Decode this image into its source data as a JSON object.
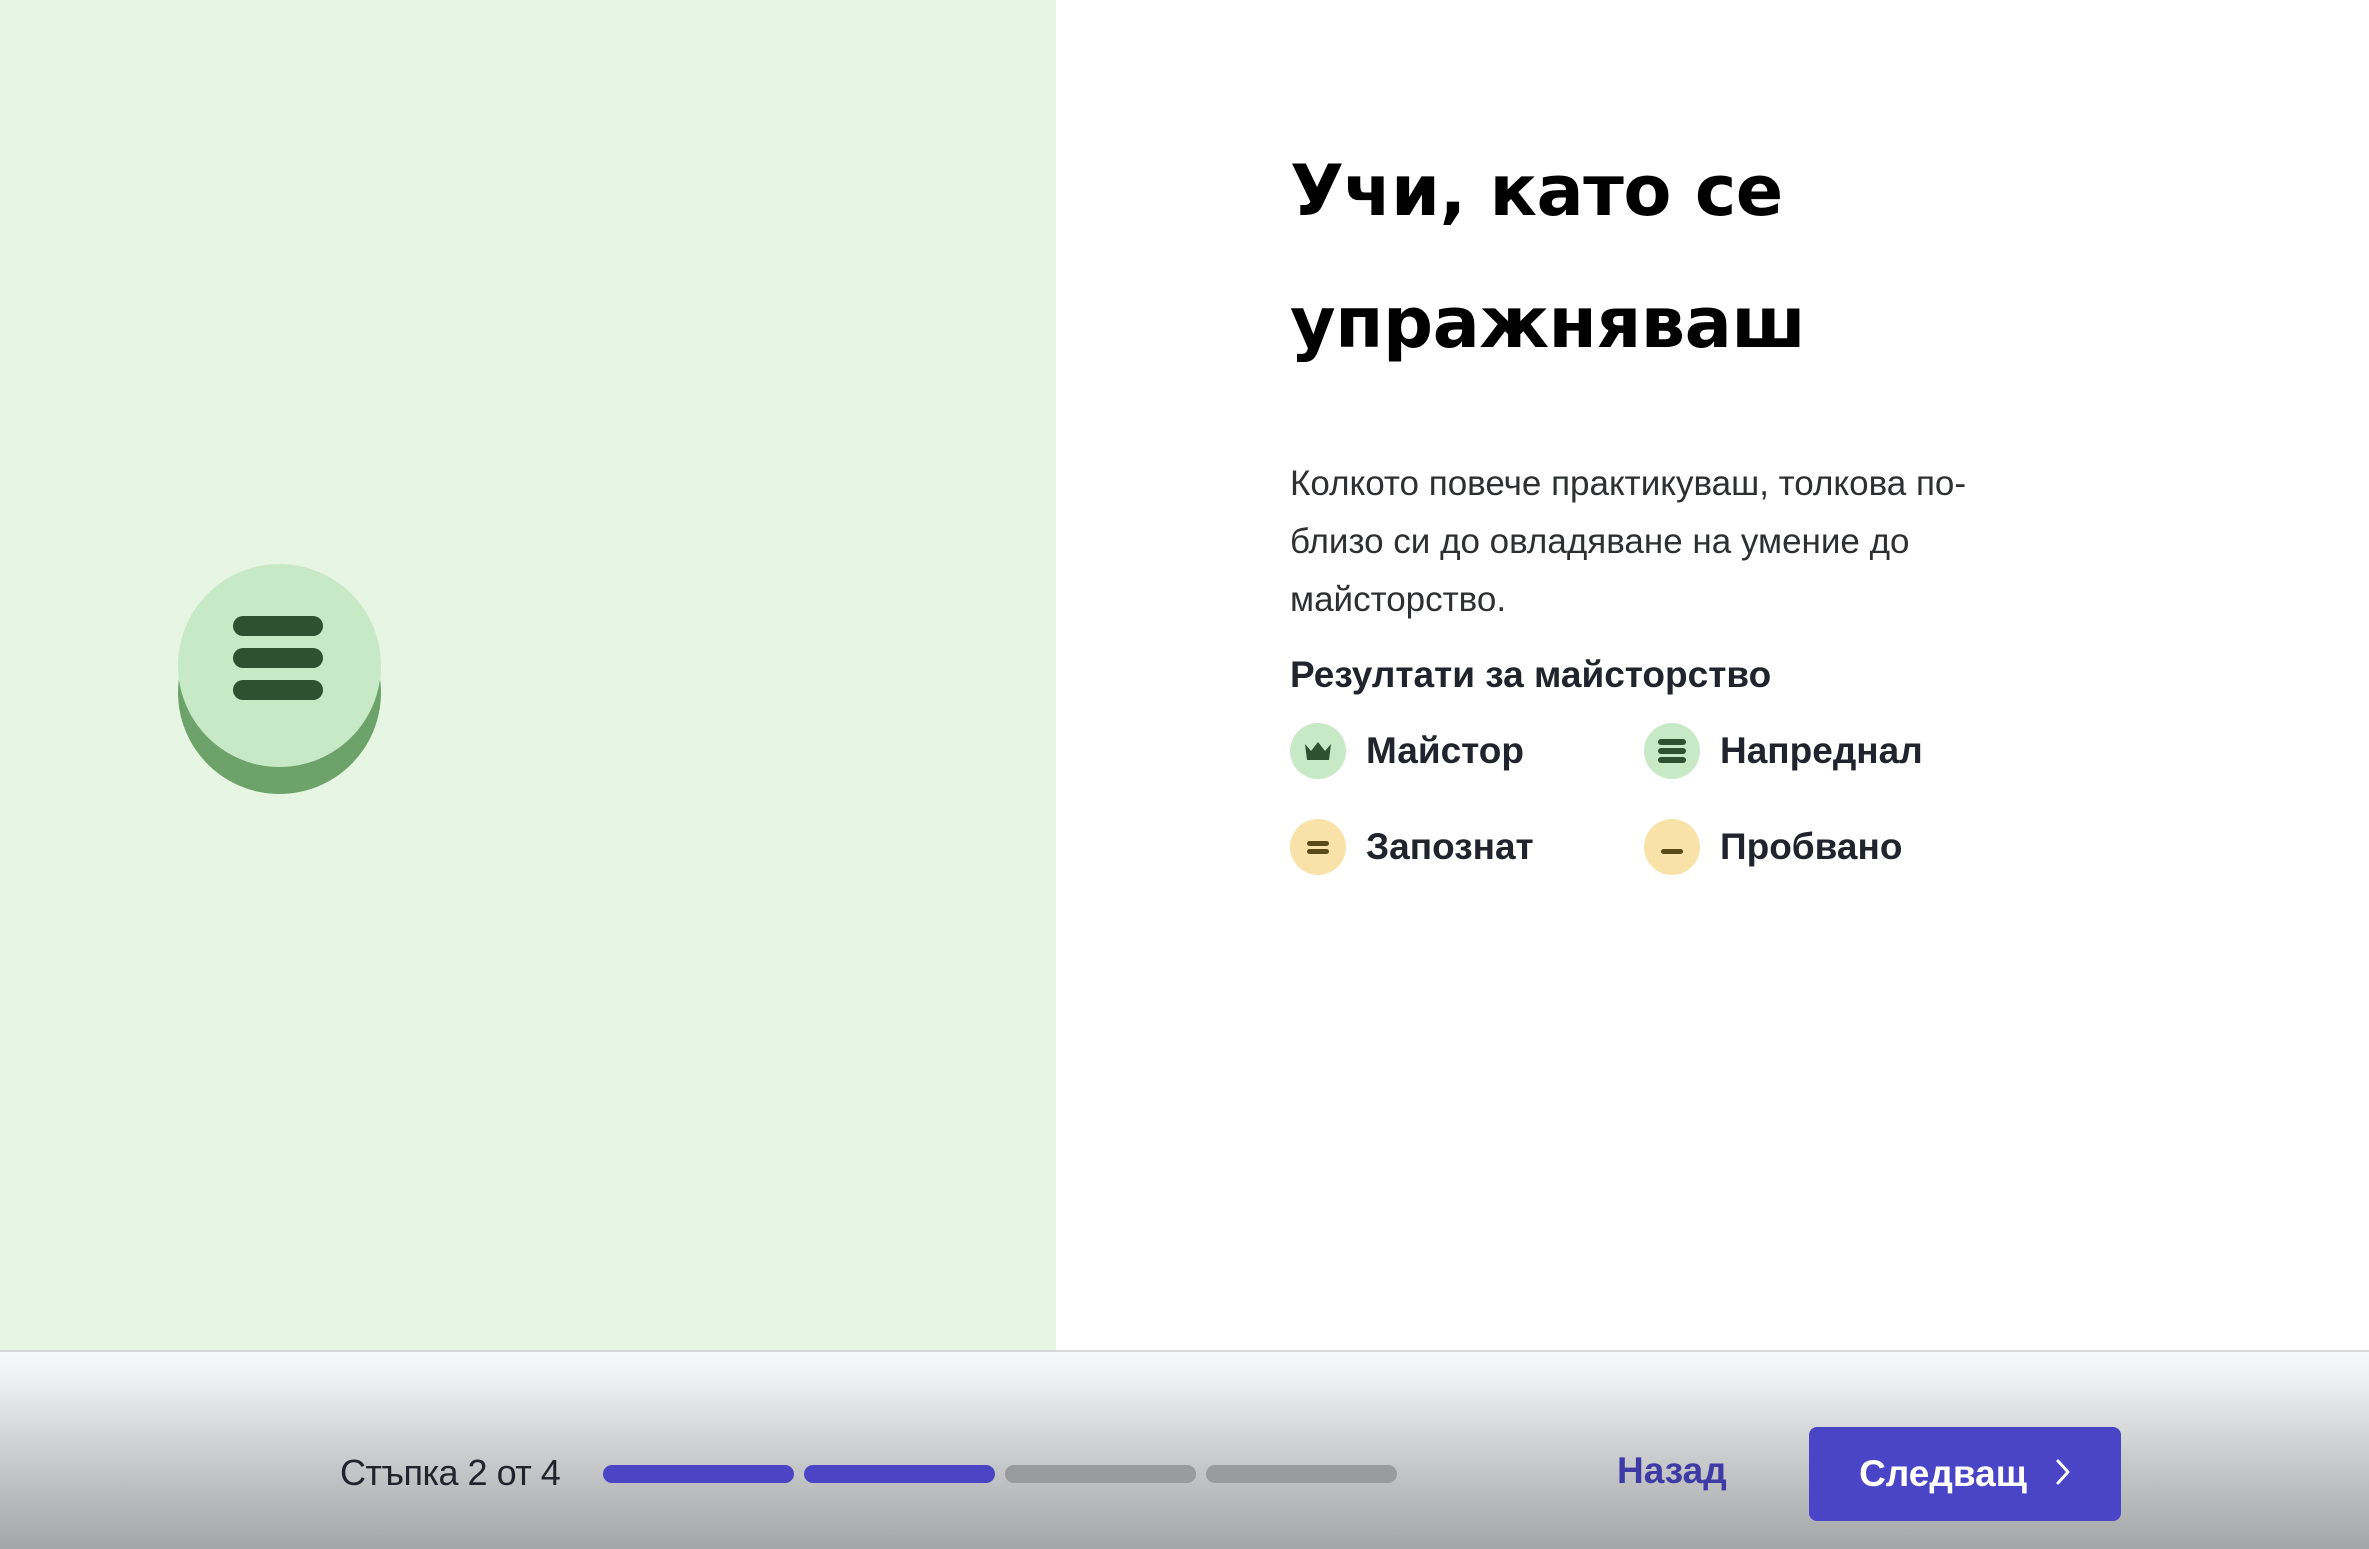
{
  "intro": {
    "title_line1": "Учи, като се",
    "title_line2": "упражняваш",
    "description_line1": "Колкото повече практикуваш, толкова по-",
    "description_line2": "близо си до овладяване на умение до",
    "description_line3": "майсторство.",
    "results_heading": "Резултати за майсторство"
  },
  "legend": [
    {
      "label": "Майстор",
      "icon": "crown-icon",
      "color": "#c8e9c5"
    },
    {
      "label": "Напреднал",
      "icon": "three-bars-icon",
      "color": "#c8e9c5"
    },
    {
      "label": "Запознат",
      "icon": "two-bars-icon",
      "color": "#f8e2a8"
    },
    {
      "label": "Пробвано",
      "icon": "one-bar-icon",
      "color": "#f8e2a8"
    }
  ],
  "footer": {
    "step_text": "Стъпка 2 от 4",
    "current_step": 2,
    "total_steps": 4,
    "back_label": "Назад",
    "next_label": "Следващ"
  },
  "colors": {
    "accent": "#4a45c7",
    "left_panel_bg": "#e7f5e3",
    "mastered_green": "#c8e9c5",
    "familiar_yellow": "#f8e2a8"
  }
}
